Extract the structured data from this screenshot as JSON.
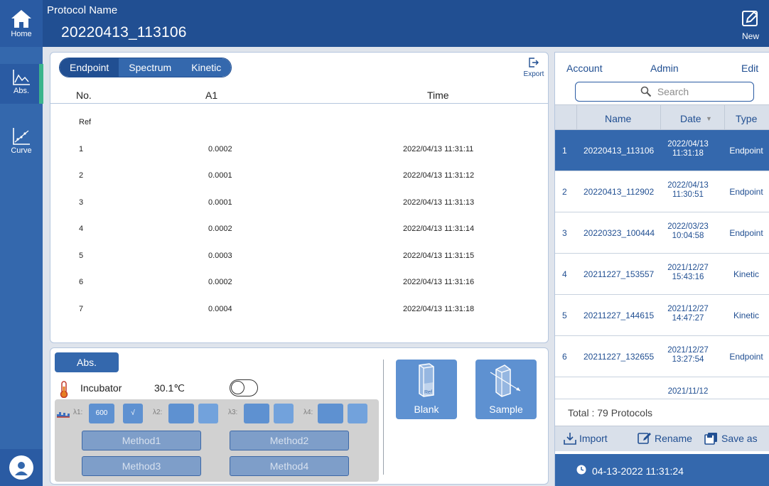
{
  "colors": {
    "primary": "#214f92",
    "accent": "#3468ad",
    "active_indicator": "#3bb48c",
    "panel_bg": "#dfe4ec"
  },
  "header": {
    "home_label": "Home",
    "protocol_label": "Protocol Name",
    "protocol_name": "20220413_113106",
    "new_label": "New"
  },
  "rail": {
    "items": [
      {
        "label": "Abs.",
        "icon": "absorbance-chart-icon",
        "active": true
      },
      {
        "label": "Curve",
        "icon": "curve-chart-icon",
        "active": false
      }
    ],
    "avatar_icon": "user-avatar-icon"
  },
  "main": {
    "tabs": [
      "Endpoint",
      "Spectrum",
      "Kinetic"
    ],
    "selected_tab": "Endpoint",
    "export_label": "Export",
    "columns": [
      "No.",
      "A1",
      "Time"
    ],
    "rows": [
      {
        "no": "Ref",
        "a1": "",
        "time": ""
      },
      {
        "no": "1",
        "a1": "0.0002",
        "time": "2022/04/13 11:31:11"
      },
      {
        "no": "2",
        "a1": "0.0001",
        "time": "2022/04/13 11:31:12"
      },
      {
        "no": "3",
        "a1": "0.0001",
        "time": "2022/04/13 11:31:13"
      },
      {
        "no": "4",
        "a1": "0.0002",
        "time": "2022/04/13 11:31:14"
      },
      {
        "no": "5",
        "a1": "0.0003",
        "time": "2022/04/13 11:31:15"
      },
      {
        "no": "6",
        "a1": "0.0002",
        "time": "2022/04/13 11:31:16"
      },
      {
        "no": "7",
        "a1": "0.0004",
        "time": "2022/04/13 11:31:18"
      }
    ]
  },
  "control": {
    "abs_label": "Abs.",
    "incubator_label": "Incubator",
    "incubator_temp": "30.1℃",
    "incubator_on": false,
    "lambda": [
      {
        "label": "λ1:",
        "value": "600",
        "checked": "√"
      },
      {
        "label": "λ2:",
        "value": "",
        "checked": ""
      },
      {
        "label": "λ3:",
        "value": "",
        "checked": ""
      },
      {
        "label": "λ4:",
        "value": "",
        "checked": ""
      }
    ],
    "methods": [
      "Method1",
      "Method2",
      "Method3",
      "Method4"
    ],
    "blank_label": "Blank",
    "blank_cuvette_text": "Ref",
    "sample_label": "Sample"
  },
  "right": {
    "tabs": [
      "Account",
      "Admin",
      "Edit"
    ],
    "search_placeholder": "Search",
    "columns": {
      "name": "Name",
      "date": "Date",
      "type": "Type"
    },
    "sort_indicator": "▼",
    "protocols": [
      {
        "idx": "1",
        "name": "20220413_113106",
        "date": "2022/04/13",
        "time": "11:31:18",
        "type": "Endpoint",
        "selected": true
      },
      {
        "idx": "2",
        "name": "20220413_112902",
        "date": "2022/04/13",
        "time": "11:30:51",
        "type": "Endpoint",
        "selected": false
      },
      {
        "idx": "3",
        "name": "20220323_100444",
        "date": "2022/03/23",
        "time": "10:04:58",
        "type": "Endpoint",
        "selected": false
      },
      {
        "idx": "4",
        "name": "20211227_153557",
        "date": "2021/12/27",
        "time": "15:43:16",
        "type": "Kinetic",
        "selected": false
      },
      {
        "idx": "5",
        "name": "20211227_144615",
        "date": "2021/12/27",
        "time": "14:47:27",
        "type": "Kinetic",
        "selected": false
      },
      {
        "idx": "6",
        "name": "20211227_132655",
        "date": "2021/12/27",
        "time": "13:27:54",
        "type": "Endpoint",
        "selected": false
      },
      {
        "idx": "",
        "name": "",
        "date": "2021/11/12",
        "time": "",
        "type": "",
        "selected": false
      }
    ],
    "total": "Total : 79 Protocols",
    "actions": [
      "Import",
      "Rename",
      "Save as"
    ],
    "datetime": "04-13-2022 11:31:24"
  }
}
